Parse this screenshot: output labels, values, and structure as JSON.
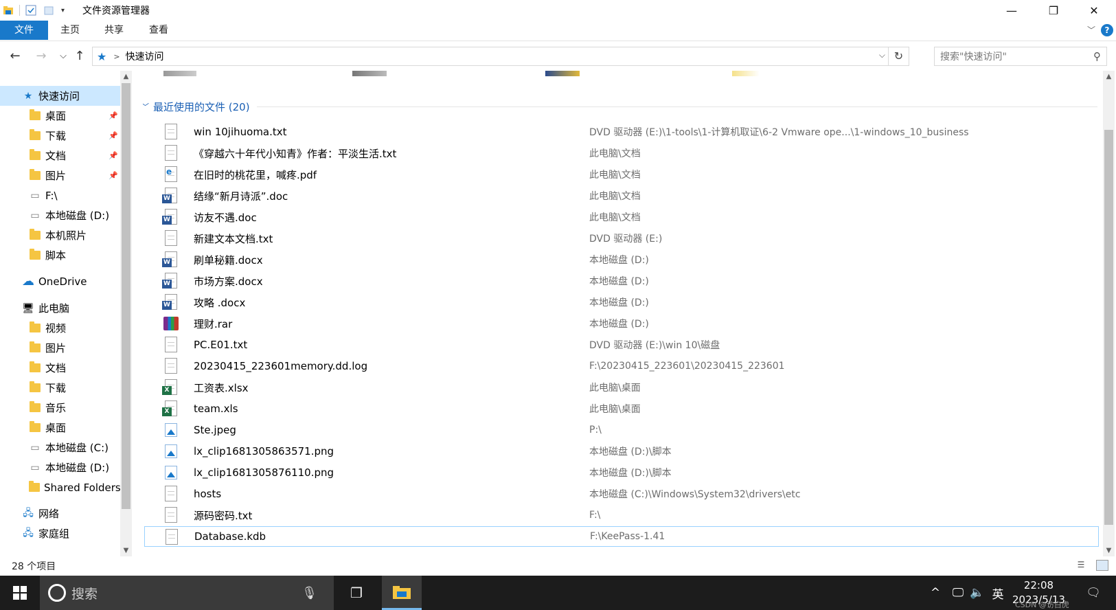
{
  "window": {
    "title": "文件资源管理器",
    "minimize_glyph": "—",
    "maximize_glyph": "❐",
    "close_glyph": "✕"
  },
  "ribbon": {
    "tabs": [
      "文件",
      "主页",
      "共享",
      "查看"
    ],
    "help": "?",
    "collapse_glyph": "﹀"
  },
  "address": {
    "location": "快速访问",
    "separator": ">",
    "search_placeholder": "搜索\"快速访问\"",
    "back": "←",
    "forward": "→",
    "recent": "⌵",
    "up": "↑",
    "dropdown": "⌵",
    "refresh": "↻",
    "search_icon": "⚲"
  },
  "nav": {
    "items": [
      {
        "label": "快速访问",
        "icon": "star-icon",
        "indent": 0,
        "selected": true
      },
      {
        "label": "桌面",
        "icon": "folder-icon",
        "indent": 1,
        "pinned": true
      },
      {
        "label": "下载",
        "icon": "download-folder-icon",
        "indent": 1,
        "pinned": true
      },
      {
        "label": "文档",
        "icon": "documents-folder-icon",
        "indent": 1,
        "pinned": true
      },
      {
        "label": "图片",
        "icon": "pictures-folder-icon",
        "indent": 1,
        "pinned": true
      },
      {
        "label": "F:\\",
        "icon": "network-drive-icon",
        "indent": 1
      },
      {
        "label": "本地磁盘 (D:)",
        "icon": "drive-icon",
        "indent": 1
      },
      {
        "label": "本机照片",
        "icon": "folder-icon",
        "indent": 1
      },
      {
        "label": "脚本",
        "icon": "folder-icon",
        "indent": 1
      },
      {
        "label": "OneDrive",
        "icon": "cloud-icon",
        "indent": 0
      },
      {
        "label": "此电脑",
        "icon": "computer-icon",
        "indent": 0
      },
      {
        "label": "视频",
        "icon": "videos-folder-icon",
        "indent": 1
      },
      {
        "label": "图片",
        "icon": "pictures-folder-icon",
        "indent": 1
      },
      {
        "label": "文档",
        "icon": "documents-folder-icon",
        "indent": 1
      },
      {
        "label": "下载",
        "icon": "download-folder-icon",
        "indent": 1
      },
      {
        "label": "音乐",
        "icon": "music-folder-icon",
        "indent": 1
      },
      {
        "label": "桌面",
        "icon": "folder-icon",
        "indent": 1
      },
      {
        "label": "本地磁盘 (C:)",
        "icon": "system-drive-icon",
        "indent": 1
      },
      {
        "label": "本地磁盘 (D:)",
        "icon": "drive-icon",
        "indent": 1
      },
      {
        "label": "Shared Folders",
        "icon": "shared-folder-icon",
        "indent": 1
      },
      {
        "label": "网络",
        "icon": "network-icon",
        "indent": 0
      },
      {
        "label": "家庭组",
        "icon": "homegroup-icon",
        "indent": 0
      }
    ]
  },
  "recent": {
    "group_title": "最近使用的文件 (20)",
    "files": [
      {
        "name": "win 10jihuoma.txt",
        "path": "DVD 驱动器 (E:)\\1-tools\\1-计算机取证\\6-2 Vmware ope...\\1-windows_10_business",
        "type": "txt"
      },
      {
        "name": "《穿越六十年代小知青》作者：平淡生活.txt",
        "path": "此电脑\\文档",
        "type": "txt"
      },
      {
        "name": "在旧时的桃花里，喊疼.pdf",
        "path": "此电脑\\文档",
        "type": "pdf"
      },
      {
        "name": "结缘“新月诗派”.doc",
        "path": "此电脑\\文档",
        "type": "doc"
      },
      {
        "name": "访友不遇.doc",
        "path": "此电脑\\文档",
        "type": "doc"
      },
      {
        "name": "新建文本文档.txt",
        "path": "DVD 驱动器 (E:)",
        "type": "txt"
      },
      {
        "name": "刷单秘籍.docx",
        "path": "本地磁盘 (D:)",
        "type": "doc"
      },
      {
        "name": "市场方案.docx",
        "path": "本地磁盘 (D:)",
        "type": "doc"
      },
      {
        "name": "攻略 .docx",
        "path": "本地磁盘 (D:)",
        "type": "doc"
      },
      {
        "name": "理财.rar",
        "path": "本地磁盘 (D:)",
        "type": "rar"
      },
      {
        "name": "PC.E01.txt",
        "path": "DVD 驱动器 (E:)\\win 10\\磁盘",
        "type": "txt"
      },
      {
        "name": "20230415_223601memory.dd.log",
        "path": "F:\\20230415_223601\\20230415_223601",
        "type": "txt"
      },
      {
        "name": "工资表.xlsx",
        "path": "此电脑\\桌面",
        "type": "xls"
      },
      {
        "name": "team.xls",
        "path": "此电脑\\桌面",
        "type": "xls"
      },
      {
        "name": "Ste.jpeg",
        "path": "P:\\",
        "type": "img"
      },
      {
        "name": "lx_clip1681305863571.png",
        "path": "本地磁盘 (D:)\\脚本",
        "type": "img"
      },
      {
        "name": "lx_clip1681305876110.png",
        "path": "本地磁盘 (D:)\\脚本",
        "type": "img"
      },
      {
        "name": "hosts",
        "path": "本地磁盘 (C:)\\Windows\\System32\\drivers\\etc",
        "type": "blank"
      },
      {
        "name": "源码密码.txt",
        "path": "F:\\",
        "type": "txt"
      },
      {
        "name": "Database.kdb",
        "path": "F:\\KeePass-1.41",
        "type": "blank",
        "selected": true
      }
    ]
  },
  "status": {
    "count": "28 个项目"
  },
  "taskbar": {
    "search_placeholder": "搜索",
    "ime": "英",
    "time": "22:08",
    "date": "2023/5/13",
    "watermark": "CSDN @访白虎"
  },
  "colors": {
    "accent": "#1979ca",
    "selection": "#cce8ff",
    "taskbar": "#1c1c1c"
  }
}
